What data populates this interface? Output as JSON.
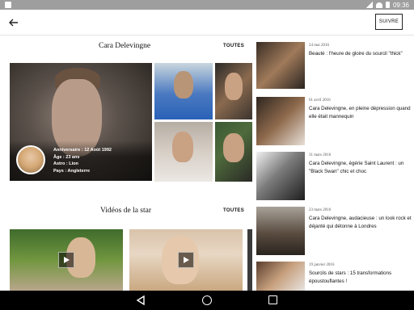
{
  "status_bar": {
    "time": "09:36",
    "icons": [
      "notification-icon",
      "signal-icon",
      "wifi-icon",
      "battery-icon"
    ]
  },
  "app_bar": {
    "back_icon": "arrow-left-icon",
    "follow_label": "SUIVRE"
  },
  "profile": {
    "name": "Cara Delevingne",
    "see_all_label": "TOUTES",
    "info": [
      "Anniversaire : 12 Août 1992",
      "Âge : 23 ans",
      "Astro : Lion",
      "Pays : Angleterre"
    ]
  },
  "videos": {
    "title": "Vidéos de la star",
    "see_all_label": "TOUTES",
    "play_icon": "play-icon"
  },
  "news": [
    {
      "date": "24 mai 2016",
      "title": "Beauté : l'heure de gloire du sourcil \"thick\""
    },
    {
      "date": "01 avril 2016",
      "title": "Cara Delevingne, en pleine dépression quand elle était mannequin"
    },
    {
      "date": "31 mars 2016",
      "title": "Cara Delevingne, égérie Saint Laurent : un \"Black Swan\" chic et choc"
    },
    {
      "date": "23 mars 2016",
      "title": "Cara Delevingne, audacieuse : un look rock et déjanté qui détonne à Londres"
    },
    {
      "date": "19 janvier 2016",
      "title": "Sourcils de stars : 15 transformations époustouflantes !"
    }
  ],
  "nav_bar": {
    "back_icon": "nav-back-icon",
    "home_icon": "nav-home-icon",
    "recent_icon": "nav-recent-icon"
  },
  "colors": {
    "status_bar": "#9e9e9e",
    "nav_bar": "#000000",
    "background": "#ececec"
  }
}
